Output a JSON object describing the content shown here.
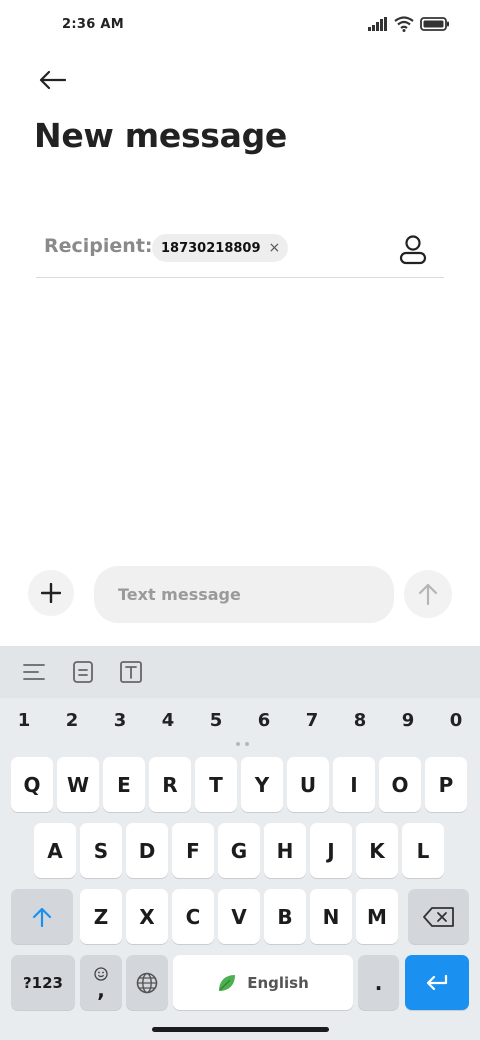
{
  "status_bar": {
    "time": "2:36 AM"
  },
  "header": {
    "title": "New message"
  },
  "recipient": {
    "label": "Recipient:",
    "chip_text": "18730218809",
    "chip_close": "×"
  },
  "compose": {
    "placeholder": "Text message"
  },
  "keyboard": {
    "numbers": [
      "1",
      "2",
      "3",
      "4",
      "5",
      "6",
      "7",
      "8",
      "9",
      "0"
    ],
    "row1": [
      "Q",
      "W",
      "E",
      "R",
      "T",
      "Y",
      "U",
      "I",
      "O",
      "P"
    ],
    "row2": [
      "A",
      "S",
      "D",
      "F",
      "G",
      "H",
      "J",
      "K",
      "L"
    ],
    "row3": [
      "Z",
      "X",
      "C",
      "V",
      "B",
      "N",
      "M"
    ],
    "symbols_label": "?123",
    "comma": ",",
    "space_label": "English",
    "period": "."
  },
  "colors": {
    "accent": "#1a91f0",
    "keyboard_bg": "#e9ecef",
    "key_gray": "#d3d7db",
    "leaf": "#4caf50"
  }
}
